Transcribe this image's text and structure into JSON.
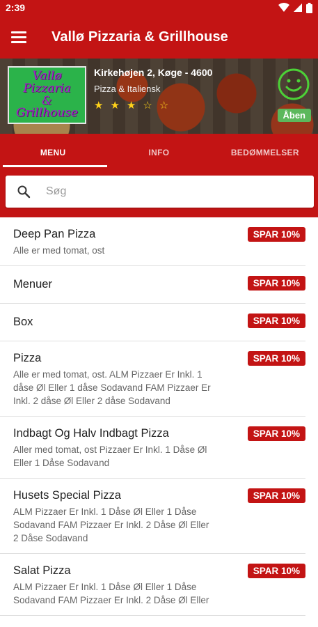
{
  "status": {
    "time": "2:39"
  },
  "appbar": {
    "title": "Vallø Pizzaria & Grillhouse"
  },
  "restaurant": {
    "logo_lines": [
      "Vallø Pizzaria",
      "&",
      "Grillhouse"
    ],
    "address": "Kirkehøjen 2, Køge - 4600",
    "category": "Pizza & Italiensk",
    "rating": {
      "filled": 3,
      "total": 5
    },
    "status_badge": "Åben"
  },
  "tabs": [
    {
      "label": "MENU"
    },
    {
      "label": "INFO"
    },
    {
      "label": "BEDØMMELSER"
    }
  ],
  "search": {
    "placeholder": "Søg"
  },
  "menu": [
    {
      "title": "Deep Pan Pizza",
      "desc": "Alle er med tomat, ost",
      "badge": "SPAR 10%"
    },
    {
      "title": "Menuer",
      "desc": "",
      "badge": "SPAR 10%"
    },
    {
      "title": "Box",
      "desc": "",
      "badge": "SPAR 10%"
    },
    {
      "title": "Pizza",
      "desc": "Alle er med tomat, ost.  ALM Pizzaer Er Inkl. 1 dåse Øl Eller 1 dåse Sodavand  FAM Pizzaer Er Inkl. 2 dåse Øl Eller 2 dåse Sodavand",
      "badge": "SPAR 10%"
    },
    {
      "title": "Indbagt Og Halv Indbagt Pizza",
      "desc": "Aller med tomat, ost  Pizzaer Er Inkl. 1 Dåse Øl Eller 1 Dåse Sodavand",
      "badge": "SPAR 10%"
    },
    {
      "title": "Husets Special Pizza",
      "desc": "ALM Pizzaer Er Inkl. 1 Dåse Øl Eller 1 Dåse Sodavand  FAM Pizzaer Er Inkl. 2 Dåse Øl Eller 2 Dåse Sodavand",
      "badge": "SPAR 10%"
    },
    {
      "title": "Salat Pizza",
      "desc": "ALM Pizzaer Er Inkl. 1 Dåse Øl Eller 1 Dåse Sodavand  FAM Pizzaer Er Inkl. 2 Dåse Øl Eller",
      "badge": "SPAR 10%"
    }
  ],
  "colors": {
    "brand": "#c31414",
    "open": "#5cb85c",
    "star": "#ffd21a",
    "logo_bg": "#2bb34a"
  },
  "icons": [
    "wifi-icon",
    "signal-icon",
    "battery-icon",
    "menu-icon",
    "smiley-icon",
    "star-icon",
    "search-icon"
  ]
}
